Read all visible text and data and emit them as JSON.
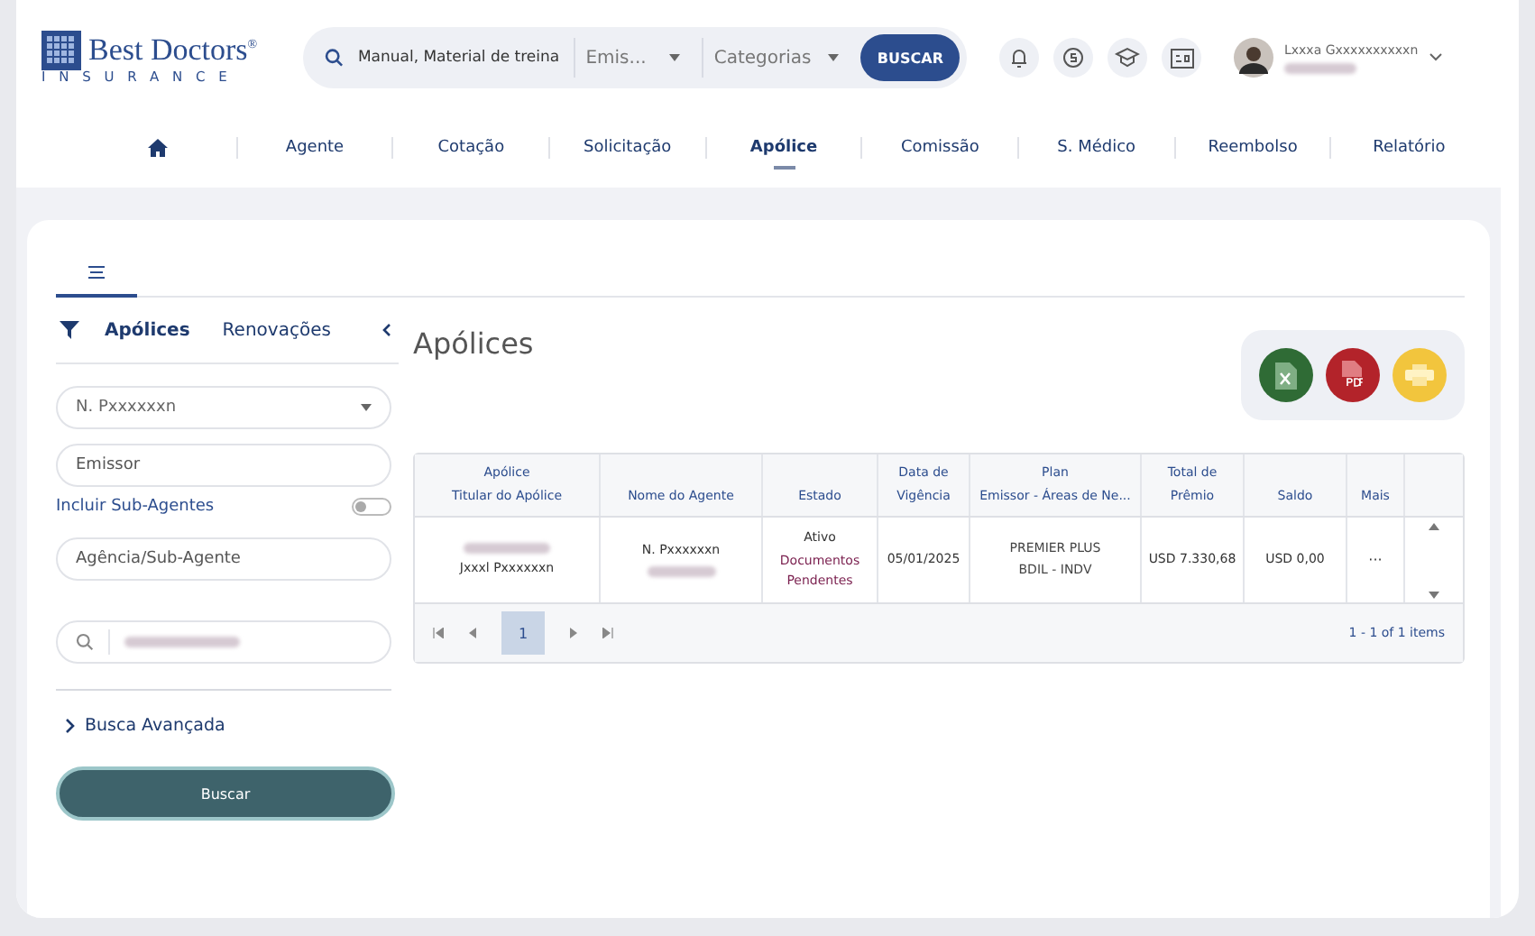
{
  "header": {
    "logo": {
      "name": "Best Doctors",
      "reg": "®",
      "sub": "INSURANCE"
    },
    "search": {
      "placeholder": "Manual, Material de treina"
    },
    "filter_1": {
      "value": "Emis..."
    },
    "filter_2": {
      "value": "Categorias"
    },
    "search_button": "BUSCAR",
    "user": {
      "name": "Lxxxa Gxxxxxxxxxxn"
    }
  },
  "nav": [
    {
      "kind": "home",
      "selected": false
    },
    {
      "label": "Agente",
      "kind": "text",
      "selected": false
    },
    {
      "label": "Cotação",
      "kind": "text",
      "selected": false
    },
    {
      "label": "Solicitação",
      "kind": "text",
      "selected": false
    },
    {
      "label": "Apólice",
      "kind": "text",
      "selected": true
    },
    {
      "label": "Comissão",
      "kind": "text",
      "selected": false
    },
    {
      "label": "S. Médico",
      "kind": "text",
      "selected": false
    },
    {
      "label": "Reembolso",
      "kind": "text",
      "selected": false
    },
    {
      "label": "Relatório",
      "kind": "text",
      "selected": false
    }
  ],
  "sidebar": {
    "tabs": [
      {
        "label": "Apólices",
        "selected": true
      },
      {
        "label": "Renovações",
        "selected": false
      }
    ],
    "select": {
      "value": "N. Pxxxxxxn"
    },
    "emissor": {
      "value": "Emissor"
    },
    "toggle": {
      "label": "Incluir Sub-Agentes",
      "on": false
    },
    "agencia": {
      "placeholder": "Agência/Sub-Agente"
    },
    "advanced": "Busca Avançada",
    "submit": "Buscar"
  },
  "main": {
    "title": "Apólices",
    "table": {
      "columns": [
        [
          "Apólice",
          "Titular do Apólice"
        ],
        [
          "Nome do Agente"
        ],
        [
          "Estado"
        ],
        [
          "Data de",
          "Vigência"
        ],
        [
          "Plan",
          "Emissor - Áreas de Ne..."
        ],
        [
          "Total de",
          "Prêmio"
        ],
        [
          "Saldo"
        ],
        [
          "Mais"
        ]
      ],
      "rows": [
        {
          "holder": "Jxxxl Pxxxxxxn",
          "agent": "N. Pxxxxxxn",
          "status": "Ativo",
          "status_note": [
            "Documentos",
            "Pendentes"
          ],
          "date": "05/01/2025",
          "plan": [
            "PREMIER PLUS",
            "BDIL - INDV"
          ],
          "premium": "USD 7.330,68",
          "balance": "USD 0,00",
          "more": "···"
        }
      ]
    },
    "pager": {
      "page": "1",
      "summary": "1 - 1 of 1 items"
    }
  }
}
